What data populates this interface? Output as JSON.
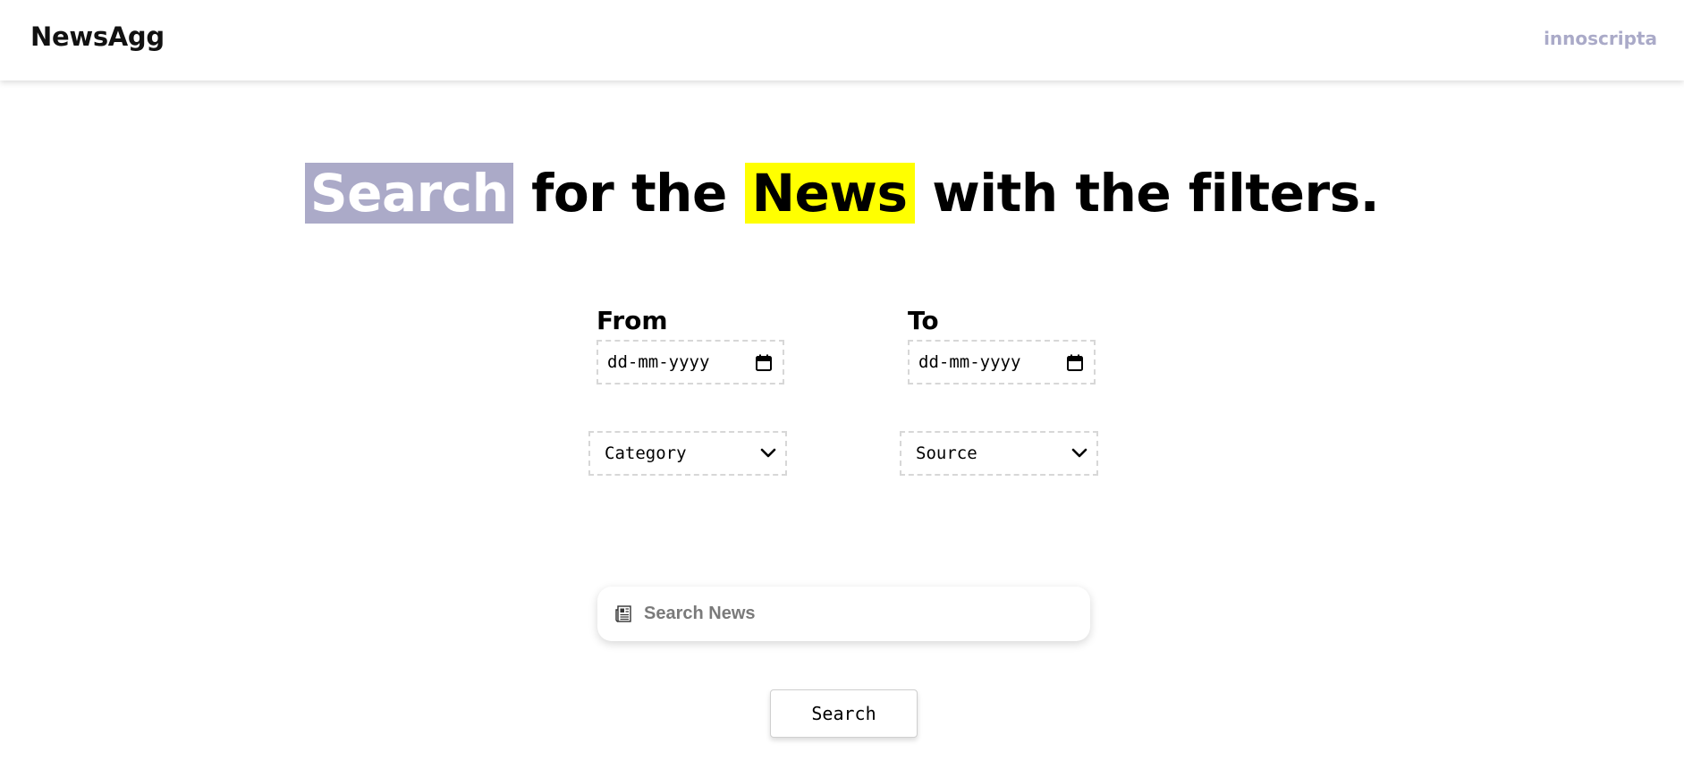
{
  "header": {
    "brand": "NewsAgg",
    "company": "innoscripta"
  },
  "headline": {
    "word_search": "Search",
    "mid_text": " for the ",
    "word_news": "News",
    "end_text": " with the filters."
  },
  "filters": {
    "from_label": "From",
    "to_label": "To",
    "from_date_placeholder": "dd-mm-yyyy",
    "to_date_placeholder": "dd-mm-yyyy",
    "category_selected": "Category",
    "source_selected": "Source",
    "icons": {
      "calendar": "calendar-icon",
      "dropdown": "chevron-down-icon"
    }
  },
  "search": {
    "placeholder": "Search News",
    "icon": "newspaper-icon",
    "button_label": "Search"
  },
  "colors": {
    "search_highlight": "#abaac8",
    "news_highlight": "#ffff00",
    "company_text": "#aaaac8"
  }
}
